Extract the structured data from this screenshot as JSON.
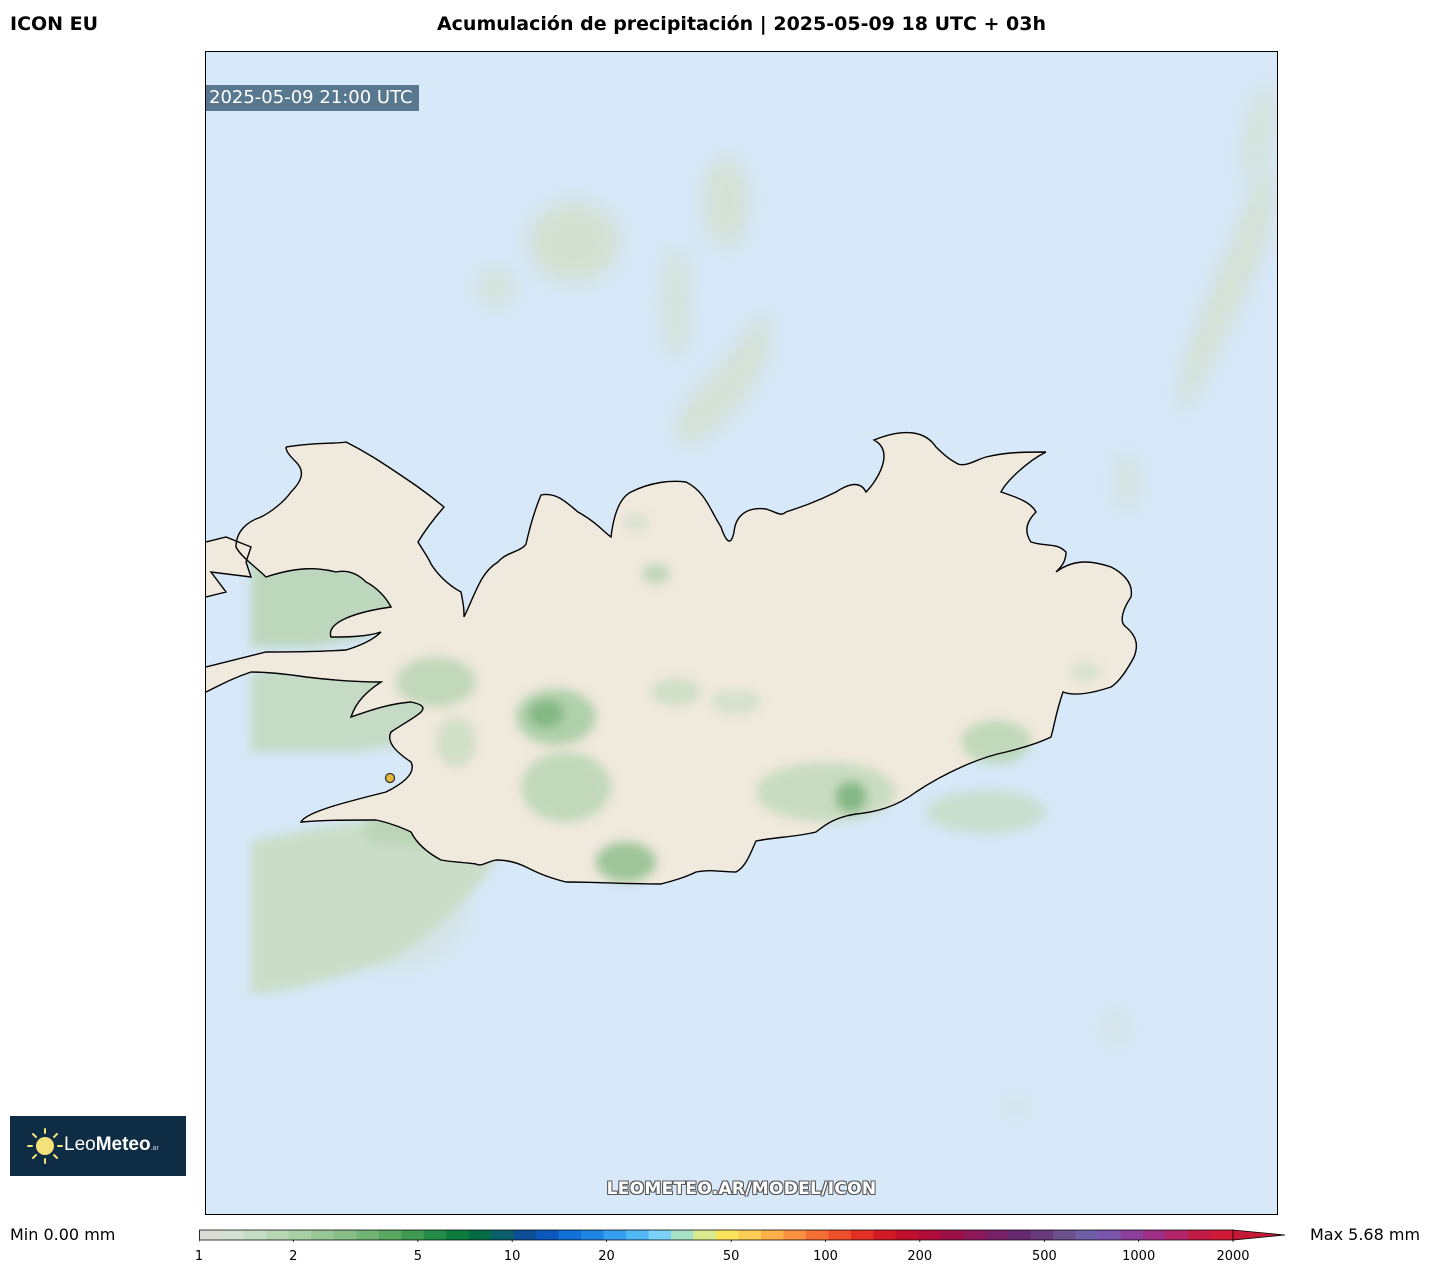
{
  "header": {
    "model": "ICON EU",
    "title": "Acumulación de precipitación | 2025-05-09 18 UTC + 03h"
  },
  "map": {
    "valid_time": "2025-05-09 21:00 UTC",
    "watermark": "LEOMETEO.AR/MODEL/ICON",
    "region": "Iceland",
    "colors": {
      "ocean": "#d7e8f8",
      "land": "#f0e9dd",
      "coastline": "#000000",
      "marker": "#e7b93a"
    }
  },
  "logo": {
    "text_light": "Leo",
    "text_bold": "Meteo",
    "suffix": ".ar",
    "icon": "sun-icon"
  },
  "legend": {
    "min_label": "Min 0.00 mm",
    "max_label": "Max 5.68 mm",
    "ticks": [
      {
        "label": "1",
        "value": 1
      },
      {
        "label": "2",
        "value": 2
      },
      {
        "label": "5",
        "value": 5
      },
      {
        "label": "10",
        "value": 10
      },
      {
        "label": "20",
        "value": 20
      },
      {
        "label": "50",
        "value": 50
      },
      {
        "label": "100",
        "value": 100
      },
      {
        "label": "200",
        "value": 200
      },
      {
        "label": "500",
        "value": 500
      },
      {
        "label": "1000",
        "value": 1000
      },
      {
        "label": "2000",
        "value": 2000
      }
    ],
    "colors": [
      "#dcdcd7",
      "#d2e0d2",
      "#c5dcc5",
      "#b6d6b4",
      "#a8d0a5",
      "#98c796",
      "#88be86",
      "#72b474",
      "#5aa761",
      "#3f9a52",
      "#238c46",
      "#0c7d3c",
      "#036c45",
      "#0a5f6a",
      "#0c4e96",
      "#0b58bd",
      "#1171d8",
      "#1d86e3",
      "#35a0ef",
      "#53b9f6",
      "#7ad0f7",
      "#a8e2c4",
      "#dbea8e",
      "#fce45d",
      "#fccd54",
      "#fcb04b",
      "#fa9040",
      "#f66f35",
      "#ee4f2b",
      "#e23025",
      "#d21a24",
      "#c1102c",
      "#b00c3a",
      "#9e104a",
      "#8c1759",
      "#781f68",
      "#66286f",
      "#6a3b7c",
      "#6c508e",
      "#6f5fa6",
      "#7a55ac",
      "#8c3f9b",
      "#9e2f84",
      "#b32568",
      "#c11c48",
      "#cf1935"
    ]
  }
}
